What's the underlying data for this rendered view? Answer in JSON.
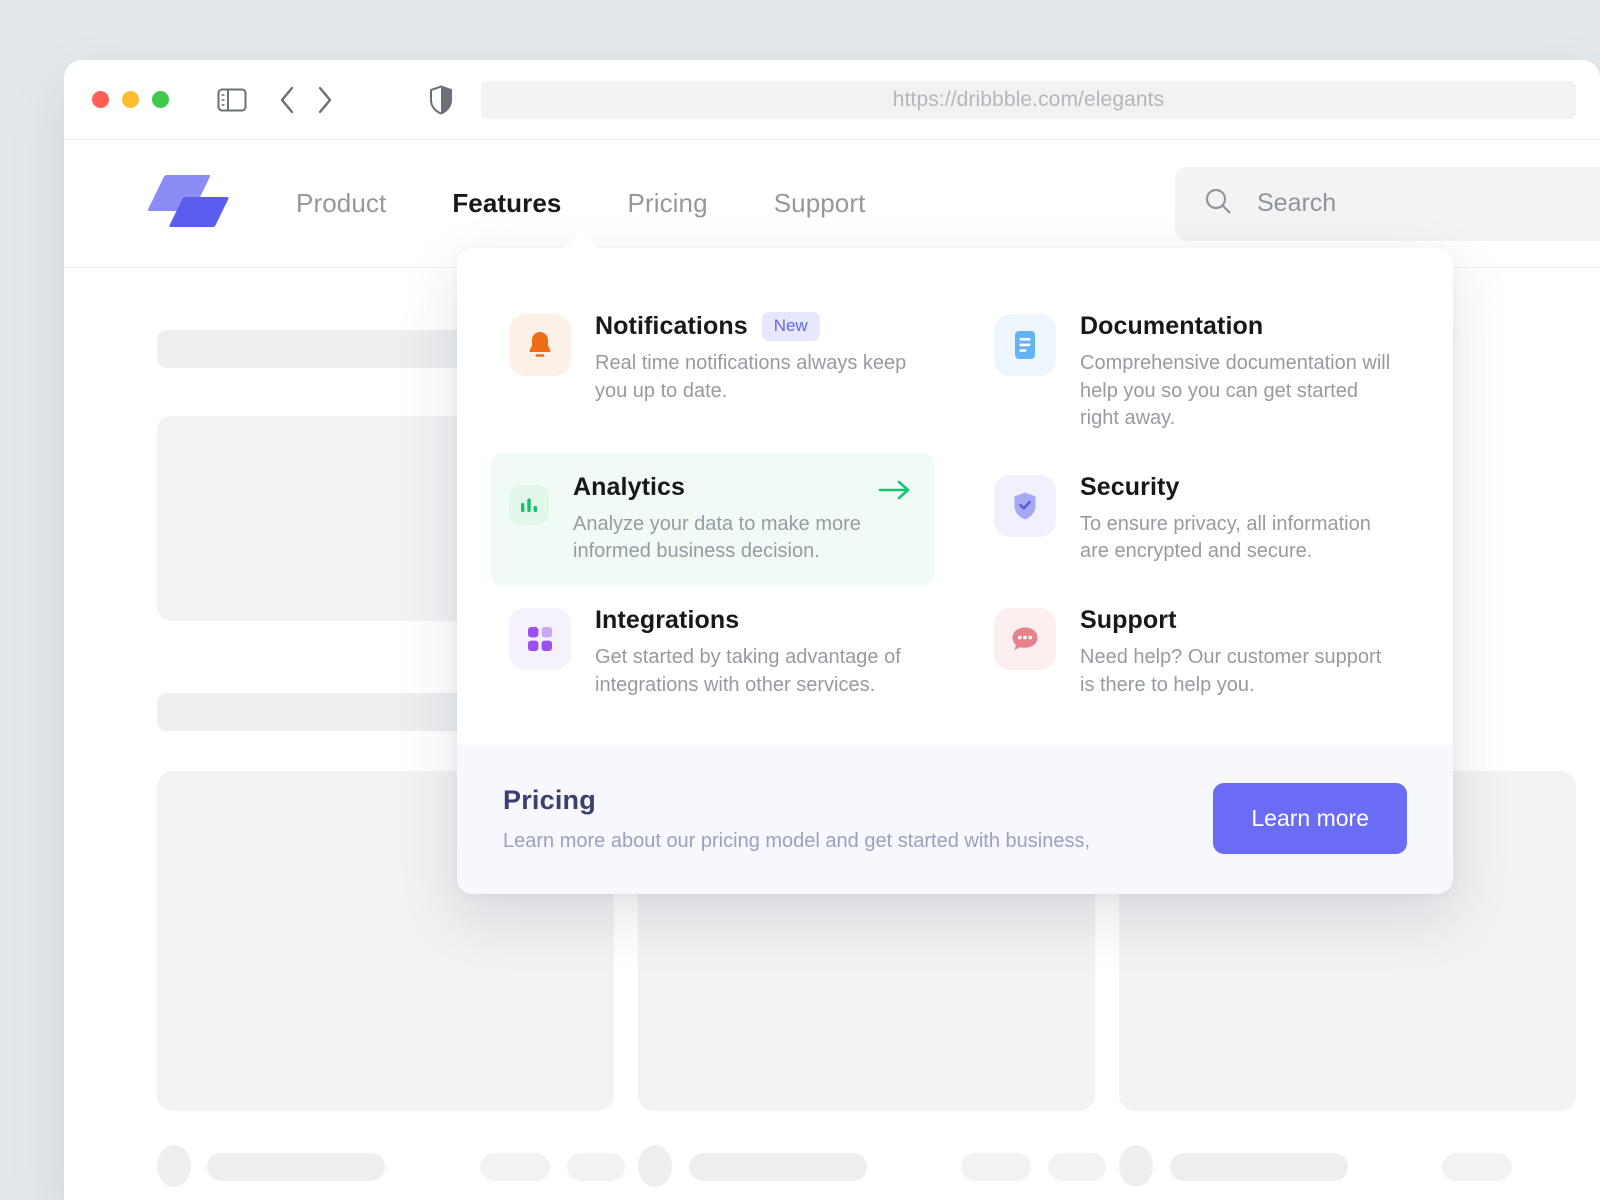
{
  "browser": {
    "url": "https://dribbble.com/elegants",
    "traffic_lights": [
      "close-red",
      "minimize-yellow",
      "maximize-green"
    ],
    "icons": {
      "sidebar": "sidebar-toggle-icon",
      "back": "back-chevron-icon",
      "forward": "forward-chevron-icon",
      "shield": "shield-privacy-icon"
    }
  },
  "header": {
    "logo_alt": "elegants-logo",
    "nav": [
      {
        "label": "Product",
        "active": false
      },
      {
        "label": "Features",
        "active": true
      },
      {
        "label": "Pricing",
        "active": false
      },
      {
        "label": "Support",
        "active": false
      }
    ],
    "search": {
      "placeholder": "Search",
      "value": ""
    }
  },
  "dropdown": {
    "items": [
      {
        "title": "Notifications",
        "badge": "New",
        "desc": "Real time notifications always keep you up to date.",
        "icon": "bell-icon",
        "tile": "peach",
        "highlight": false,
        "arrow": false
      },
      {
        "title": "Documentation",
        "badge": "",
        "desc": "Comprehensive documentation will help you so you can get started right away.",
        "icon": "document-icon",
        "tile": "sky",
        "highlight": false,
        "arrow": false
      },
      {
        "title": "Analytics",
        "badge": "",
        "desc": "Analyze your data to make more informed business decision.",
        "icon": "bar-chart-icon",
        "tile": "mint",
        "highlight": true,
        "arrow": true
      },
      {
        "title": "Security",
        "badge": "",
        "desc": "To ensure privacy, all information are encrypted and secure.",
        "icon": "shield-check-icon",
        "tile": "indigo",
        "highlight": false,
        "arrow": false
      },
      {
        "title": "Integrations",
        "badge": "",
        "desc": "Get started by taking advantage of integrations with other services.",
        "icon": "grid-squares-icon",
        "tile": "laven",
        "highlight": false,
        "arrow": false
      },
      {
        "title": "Support",
        "badge": "",
        "desc": "Need help? Our customer support is there to help you.",
        "icon": "chat-bubble-icon",
        "tile": "rose",
        "highlight": false,
        "arrow": false
      }
    ],
    "footer": {
      "title": "Pricing",
      "subtitle": "Learn more about our pricing model and get started with business,",
      "button": "Learn more"
    }
  },
  "colors": {
    "accent": "#6a6cf5",
    "accent_light": "#8b8df4",
    "highlight_green": "#18c473",
    "badge_bg": "#e7e8fd",
    "page_bg": "#e3e8ec"
  }
}
